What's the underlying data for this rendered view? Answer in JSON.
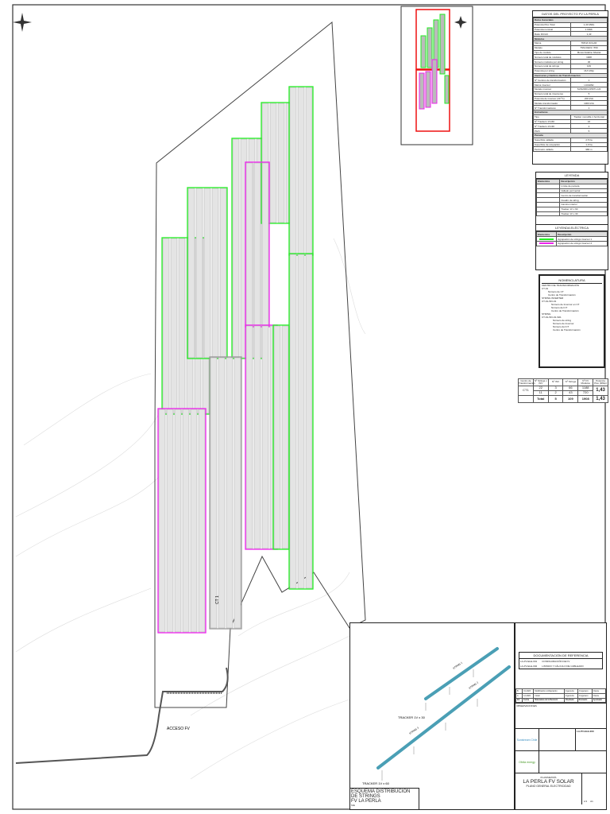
{
  "plan": {
    "access_label": "ACCESO FV",
    "north_label": "N",
    "ct_label": "CT 1"
  },
  "colors": {
    "string_green": "#22ee22",
    "string_magenta": "#ee22ee",
    "keyplan_frame": "#ee1111"
  },
  "data_table": {
    "title": "DATOS DEL PROYECTO FV LA PERLA",
    "sections": [
      {
        "name": "Datos Generales",
        "rows": [
          [
            "Potencia Pico Total",
            "1,43 MWp"
          ],
          [
            "Potencia nominal",
            "1 MWn"
          ],
          [
            "Ratio DC/AC",
            "1,43"
          ]
        ]
      },
      {
        "name": "Módulos",
        "rows": [
          [
            "Marca",
            "TRINA SOLAR"
          ],
          [
            "Modelo",
            "TSM-DE19 / 550"
          ],
          [
            "Tipo de módulo",
            "Monocristalino bifacial"
          ],
          [
            "Número total de módulos",
            "1908"
          ],
          [
            "Número módulos por string",
            "30"
          ],
          [
            "Número total de strings",
            "109"
          ],
          [
            "Potencia por string",
            "16,5 kWp"
          ]
        ]
      },
      {
        "name": "Inversores y Centros de Transformación",
        "rows": [
          [
            "Nº Centros de transformación",
            "1"
          ],
          [
            "Marca inversor",
            "HUAWEI"
          ],
          [
            "Modelo inversor",
            "SUN2000-215KTL-H3"
          ],
          [
            "Número total de inversores",
            "5"
          ],
          [
            "Potencia de inversor (40 ºC)",
            "200 kVA"
          ],
          [
            "Modelo transformador",
            "1000 kVA"
          ],
          [
            "Nº Transformadores",
            "1"
          ]
        ]
      },
      {
        "name": "Estructuras",
        "rows": [
          [
            "Tipo",
            "Tracker monofila 1 horizontal"
          ],
          [
            "Nº Trackers 1Vx60",
            "16"
          ],
          [
            "Nº Trackers 1Vx30",
            "2"
          ],
          [
            "Pitch",
            "5"
          ]
        ]
      },
      {
        "name": "Parcela",
        "rows": [
          [
            "Superficie vallada",
            "2,5 ha"
          ],
          [
            "Superficie de ocupación",
            "1,9 ha"
          ],
          [
            "Perímetro vallado",
            "980 m"
          ]
        ]
      }
    ]
  },
  "legend": {
    "title": "LEYENDA",
    "col_elements": "Elementos",
    "col_description": "Descripción",
    "items": [
      "Límite de parcela",
      "Vallado perimetral",
      "Centro de transformación",
      "Cuadro de string",
      "Camino interior",
      "Tracker 1V x 60",
      "Tracker 1V x 30"
    ]
  },
  "electric_legend": {
    "title": "LEYENDA ELÉCTRICA",
    "col_elements": "Elementos",
    "col_description": "Descripción",
    "items": [
      "Agrupación de strings inversor 1",
      "Agrupación de strings inversor 2"
    ]
  },
  "nomenclature": {
    "title": "NOMENCLATURA",
    "heading": "CENTRO DE TRANSFORMACIÓN",
    "code1": "CT-01",
    "sub1": [
      "Número de CT",
      "Centro de Transformación"
    ],
    "heading2": "STRING INVERTER",
    "code2": "CT-01-INV-01",
    "sub2": [
      "Número de Inversor en CT",
      "Número del CT",
      "Centro de Transformación"
    ],
    "heading3": "STRING",
    "code3": "CT-01-INV-01-S01",
    "sub3": [
      "Número de string",
      "Número de Inversor",
      "Número del CT",
      "Centro de Transformación"
    ]
  },
  "summary_table": {
    "headers": [
      "Centro de Transformación",
      "Nº Strings x INV",
      "Nº INV",
      "Nº Strings",
      "Nº FV Módulos",
      "Potencia Pico (MWp)"
    ],
    "rows": [
      [
        "CT1",
        "22",
        "3",
        "66",
        "1188",
        ""
      ],
      [
        "",
        "11",
        "2",
        "43",
        "720",
        ""
      ]
    ],
    "ct_power": "1,43",
    "total": [
      "Total",
      "5",
      "109",
      "1908",
      "1,43"
    ]
  },
  "strings_diagram": {
    "tracker_30": "TRACKER 1V x 30",
    "tracker_60": "TRACKER 1V x 60",
    "string1": "STRING 1",
    "string2": "STRING 2",
    "string3": "STRING 3",
    "title": "ESQUEMA DISTRIBUCION DE STRINGS",
    "subtitle": "FV LA PERLA",
    "scale": "S/E"
  },
  "references": {
    "title": "DOCUMENTACIÓN DE REFERENCIA",
    "rows": [
      [
        "LA-PV-ELE-001",
        "CONFIGURACIÓN DE FV"
      ],
      [
        "LA-PV-ELE-002",
        "LISTADO Y CÁLCULO DE CABLEADO"
      ]
    ]
  },
  "revisions": {
    "rows": [
      [
        "B",
        "01-2023",
        "Modificación configuración",
        "Ingeniería",
        "J.Ingeniero",
        "Cliente"
      ],
      [
        "A",
        "12-2022",
        "Inicial",
        "Ingeniería",
        "J.Ingeniero",
        "Cliente"
      ]
    ],
    "headers": [
      "Ed.",
      "Fecha",
      "Naturaleza de la Revisión",
      "Diseñado",
      "Revisado",
      "Aprobado"
    ]
  },
  "title_block": {
    "observations": "OBSERVACIONES",
    "client": "Sunstream Chile",
    "developer": "Ofelia energy",
    "project_label": "PLANIMETRÍA",
    "project": "LA PERLA FV SOLAR",
    "drawing": "PLANO GENERAL ELECTRICIDAD",
    "doc_no": "LA-PV-ELE-000",
    "scale": "S/E",
    "sheet": "1/1",
    "format": "A1"
  }
}
